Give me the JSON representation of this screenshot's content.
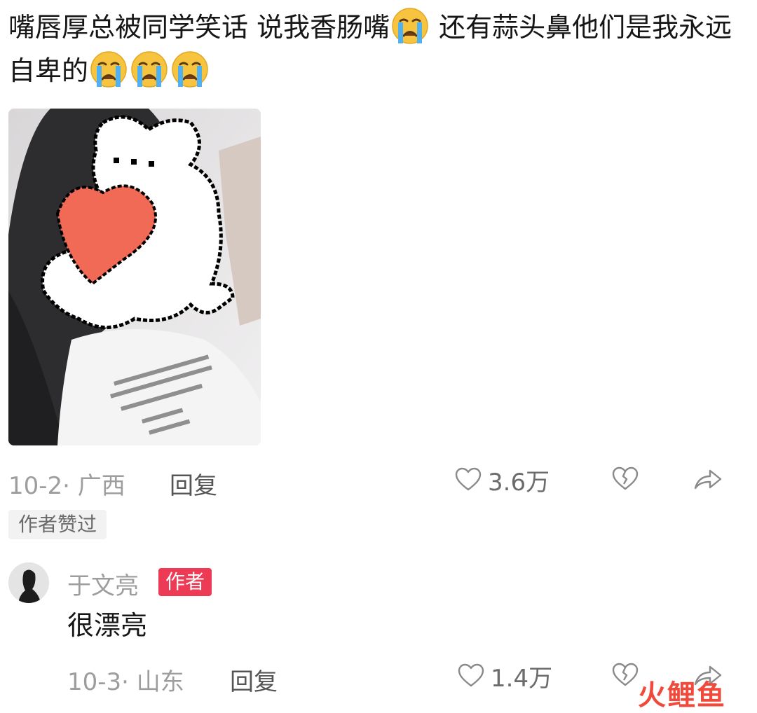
{
  "comment": {
    "text_part1": "嘴唇厚总被同学笑话 说我香肠嘴",
    "text_part2": " 还有蒜头鼻他们是我永远自卑的",
    "emoji_icon": "crying-face-icon",
    "date_location": "10-2· 广西",
    "reply_label": "回复",
    "like_count": "3.6万",
    "author_liked_badge": "作者赞过"
  },
  "reply": {
    "username": "于文亮",
    "author_badge": "作者",
    "text": "很漂亮",
    "date_location": "10-3· 山东",
    "reply_label": "回复",
    "like_count": "1.4万"
  },
  "watermark": {
    "char1": "火",
    "char2": "鲤",
    "char3": "鱼"
  },
  "colors": {
    "badge_red": "#ee3b55",
    "meta_grey": "#9d9d9d",
    "watermark_red": "#f04a3c"
  }
}
